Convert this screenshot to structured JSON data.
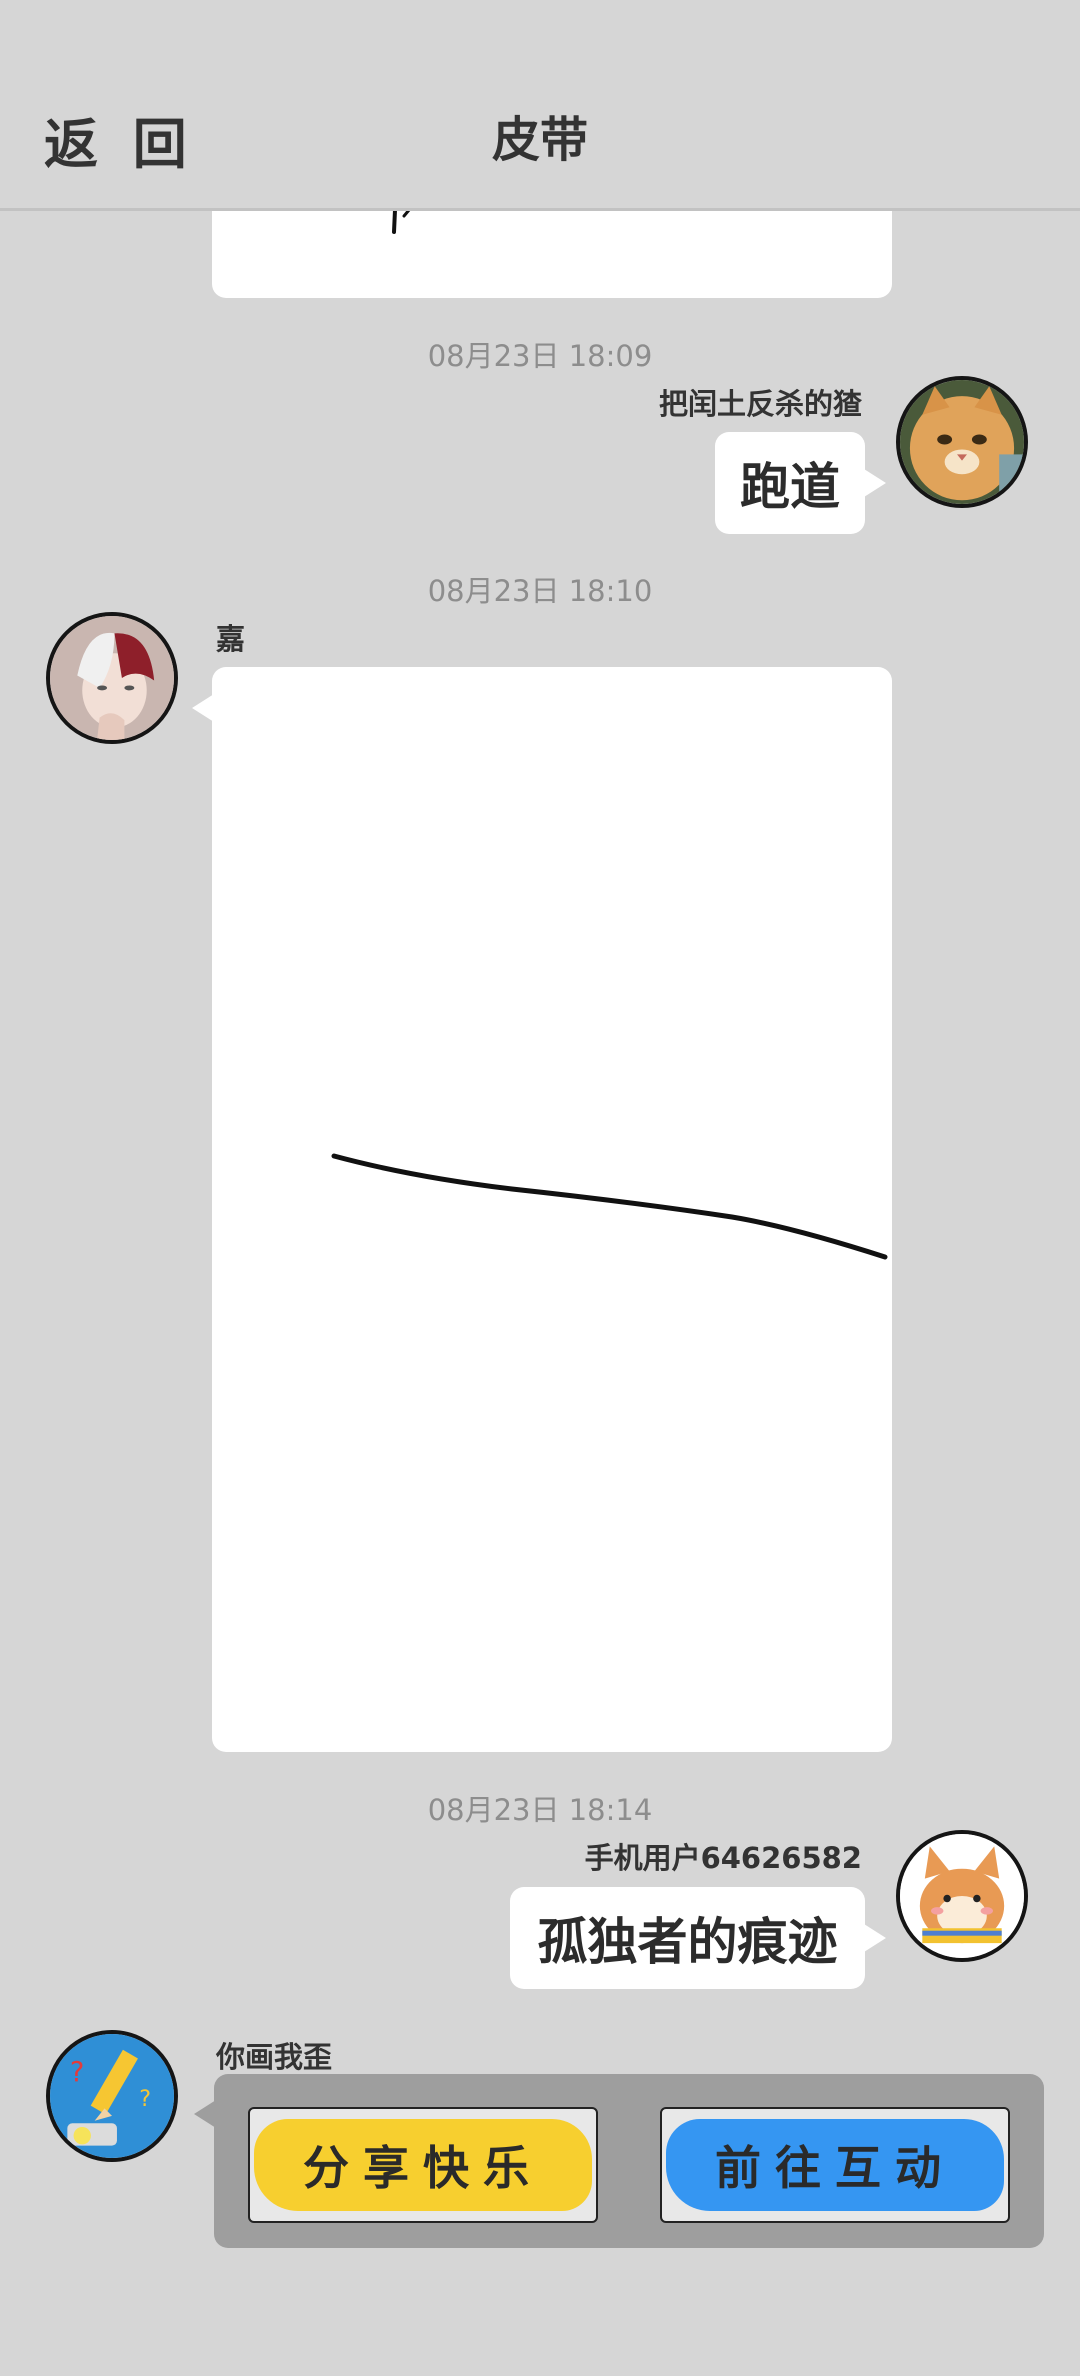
{
  "header": {
    "back_label": "返 回",
    "title": "皮带"
  },
  "colors": {
    "background": "#d6d6d6",
    "bubble": "#ffffff",
    "share_yellow": "#f7cf2f",
    "go_blue": "#3596f2"
  },
  "messages": [
    {
      "timestamp": "08月23日  18:09",
      "sender": "把闰土反杀的猹",
      "side": "right",
      "text": "跑道",
      "avatar_icon": "orange-cat-avatar"
    },
    {
      "timestamp": "08月23日  18:10",
      "sender": "嘉",
      "side": "left",
      "type": "drawing",
      "avatar_icon": "anime-boy-avatar"
    },
    {
      "timestamp": "08月23日  18:14",
      "sender": "手机用户64626582",
      "side": "right",
      "text": "孤独者的痕迹",
      "avatar_icon": "shiba-dog-avatar"
    },
    {
      "sender": "你画我歪",
      "side": "left",
      "type": "game-card",
      "avatar_icon": "pencil-game-avatar",
      "buttons": {
        "share": "分享快乐",
        "go": "前往互动"
      }
    }
  ]
}
